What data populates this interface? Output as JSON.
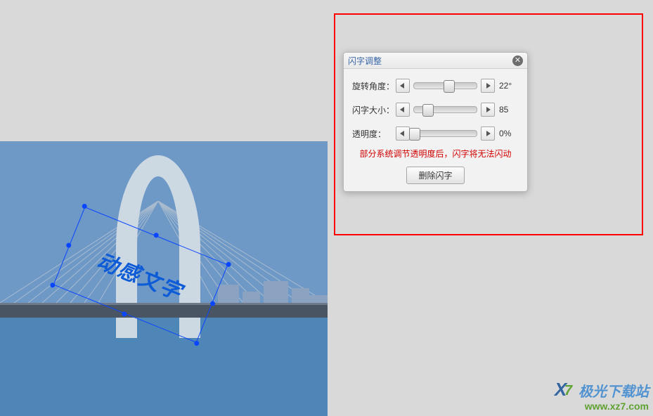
{
  "canvas": {
    "overlay_text": "动感文字",
    "rotation_deg": 22
  },
  "panel": {
    "title": "闪字调整",
    "rows": {
      "rotation": {
        "label": "旋转角度：",
        "value": 22,
        "unit": "°",
        "min": -180,
        "max": 180,
        "percent": 55
      },
      "size": {
        "label": "闪字大小：",
        "value": 85,
        "unit": "",
        "min": 0,
        "max": 400,
        "percent": 21
      },
      "opacity": {
        "label": "透明度：",
        "value": 0,
        "unit": "%",
        "min": 0,
        "max": 100,
        "percent": 0
      }
    },
    "warning": "部分系统调节透明度后，闪字将无法闪动",
    "delete_label": "删除闪字"
  },
  "icons": {
    "close": "✕"
  },
  "watermark": {
    "brand": "极光下载站",
    "url": "www.xz7.com"
  }
}
